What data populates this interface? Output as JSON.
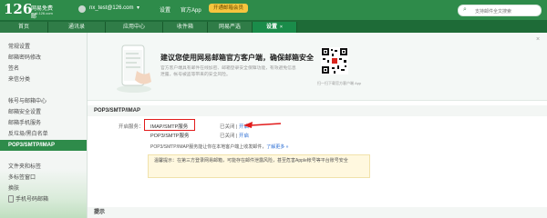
{
  "header": {
    "logo_number": "126",
    "logo_text": "网易免费邮",
    "logo_sub": "mail.126.com",
    "user_email": "nx_test@126.com",
    "settings": "设置",
    "app": "官方App",
    "member": "开通邮箱会员",
    "search_placeholder": "支持邮件全文搜索"
  },
  "tabs": [
    {
      "label": "首页"
    },
    {
      "label": "通讯录"
    },
    {
      "label": "应用中心"
    },
    {
      "label": "收件箱"
    },
    {
      "label": "网易严选"
    },
    {
      "label": "设置",
      "close": "×"
    }
  ],
  "sidebar": {
    "items": [
      {
        "label": "常规设置"
      },
      {
        "label": "邮箱密码修改"
      },
      {
        "label": "签名"
      },
      {
        "label": "来信分类"
      },
      {
        "label": "帐号与邮箱中心"
      },
      {
        "label": "邮箱安全设置"
      },
      {
        "label": "邮箱手机服务"
      },
      {
        "label": "反垃圾/黑白名单"
      },
      {
        "label": "POP3/SMTP/IMAP"
      },
      {
        "label": "文件夹和标签"
      },
      {
        "label": "多标签窗口"
      },
      {
        "label": "换肤"
      },
      {
        "label": "手机号码邮箱"
      }
    ]
  },
  "banner": {
    "title": "建议您使用网易邮箱官方客户端，确保邮箱安全",
    "desc": "官方客户端具有邮件在线加密、邮箱登录安全保障功能，有效避免信息泄露，帐号被盗等带来的安全风险。",
    "qr_caption": "扫一扫下载官方客户端 App",
    "close": "×"
  },
  "section": {
    "title": "POP3/SMTP/IMAP",
    "enable_label": "开启服务：",
    "services": [
      {
        "name": "IMAP/SMTP服务",
        "status": "已关闭",
        "sep": " | ",
        "action": "开启"
      },
      {
        "name": "POP3/SMTP服务",
        "status": "已关闭",
        "sep": " | ",
        "action": "开启"
      }
    ],
    "info": "POP3/SMTP/IMAP服务能让你在本地客户端上收发邮件，",
    "info_link": "了解更多 »",
    "tip": "温馨提示：在第三方登录网易邮箱，可能存在邮件泄露风险，甚至危害Apple帐号等平台账号安全"
  },
  "footer": {
    "title": "提示"
  },
  "colors": {
    "brand_green": "#2e8b4a",
    "link_blue": "#2a6dd3",
    "highlight_red": "#e21b1b"
  }
}
